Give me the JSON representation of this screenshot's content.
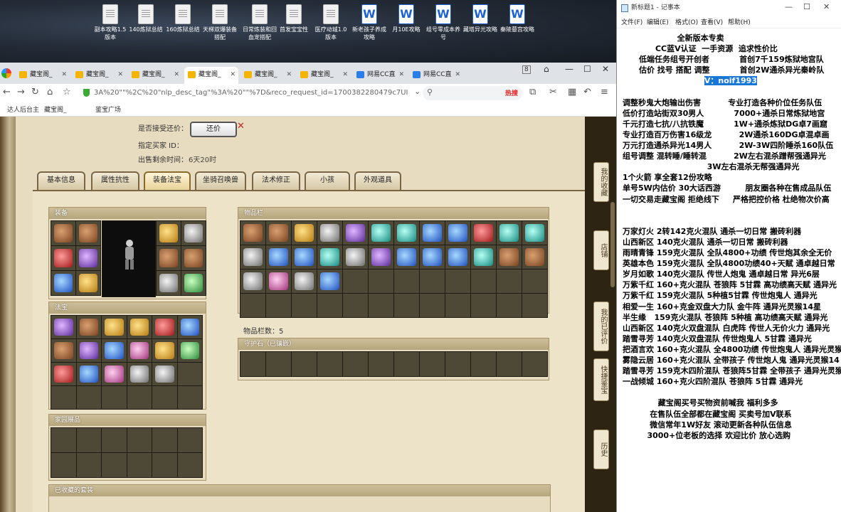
{
  "desktop": {
    "icons": [
      {
        "label": "副本攻略1.5版本",
        "type": "txt"
      },
      {
        "label": "140炼狱总结",
        "type": "txt"
      },
      {
        "label": "160炼狱总结",
        "type": "txt"
      },
      {
        "label": "天梯双爆装备搭配",
        "type": "txt"
      },
      {
        "label": "日常炼装和回血宠搭配",
        "type": "txt"
      },
      {
        "label": "首发宝宝性",
        "type": "txt"
      },
      {
        "label": "医疗动城1.0版本",
        "type": "txt"
      },
      {
        "label": "新老孩子养成攻略",
        "type": "wps"
      },
      {
        "label": "月10E攻略",
        "type": "wps"
      },
      {
        "label": "组号零成本养号",
        "type": "wps"
      },
      {
        "label": "藏塔异光攻略",
        "type": "wps"
      },
      {
        "label": "秦陵墓宫攻略",
        "type": "wps"
      }
    ]
  },
  "browser": {
    "tabs": [
      {
        "label": "藏宝阁_",
        "icon": "cbg-icon"
      },
      {
        "label": "藏宝阁_",
        "icon": "cbg-icon"
      },
      {
        "label": "藏宝阁_",
        "icon": "cbg-icon"
      },
      {
        "label": "藏宝阁_",
        "icon": "cbg-icon",
        "active": true
      },
      {
        "label": "藏宝阁_",
        "icon": "cbg-icon"
      },
      {
        "label": "藏宝阁_",
        "icon": "cbg-icon"
      },
      {
        "label": "网易CC直",
        "icon": "cc-icon"
      },
      {
        "label": "网易CC直",
        "icon": "cc-icon"
      }
    ],
    "tab_count": "8",
    "url": "3A%20\"\"%2C%20\"nlp_desc_tag\"%3A%20\"\"%7D&reco_request_id=1700382280479c7UI",
    "search_hot": "热搜",
    "bookmarks": [
      "达人后台主",
      "藏宝阁_",
      "鉴宝广场"
    ]
  },
  "trade": {
    "accept_counter_label": "是否接受还价：",
    "counter_button": "还价",
    "buyer_label": "指定买家 ID：",
    "time_label": "出售剩余时间：",
    "time_value": "6天20时"
  },
  "page_tabs": [
    {
      "label": "基本信息"
    },
    {
      "label": "属性抗性"
    },
    {
      "label": "装备法宝",
      "active": true
    },
    {
      "label": "坐骑召唤兽"
    },
    {
      "label": "法术修正"
    },
    {
      "label": "小孩"
    },
    {
      "label": "外观道具"
    }
  ],
  "panels": {
    "equip_title": "装备",
    "fabao_title": "法宝",
    "home_title": "家园展品",
    "inventory_title": "物品栏",
    "inventory_count": "物品栏数：5",
    "guard_title": "守护石（已镶嵌）",
    "collected_title": "已收藏的套装"
  },
  "right_rail": [
    "我的收藏",
    "店铺",
    "我的已评价",
    "快捷鉴宝",
    "历史"
  ],
  "notepad": {
    "title": "新标题1 - 记事本",
    "menu": [
      "文件(F)",
      "编辑(E)",
      "格式(O)",
      "查看(V)",
      "帮助(H)"
    ],
    "lines": [
      "                    全新版本专卖",
      "            CC蓝V认证  一手资源  追求性价比",
      "      低端任务组号开创者           首创7千159炼狱地宫队",
      "      估价 找号 搭配 调整           首创2W通杀异光秦岭队",
      "                              V：noif1993",
      "",
      "调整秒鬼大炮输出伤害          专业打造各种价位任务队伍",
      "低价打造站街双30男人           7000+通杀日常炼狱地宫",
      "千元打造七抗/八抗铁魔           1W+通杀炼狱DG卓7画窟",
      "专业打造百万伤害16级龙          2W通杀160DG卓混卓画",
      "万元打造通杀异光14男人          2W-3W四阶睡杀160队伍",
      "组号调整 混转睡/睡转混          2W左右混杀蹭帮强通异光",
      "                               3W左右混杀无帮强通异光",
      "1个火箭 享全套12份攻略",
      "单号5W内估价 30大话西游         朋友圈各种在售成品队伍",
      "一切交易走藏宝阁 拒绝线下     严格把控价格 杜绝物次价高",
      "",
      "",
      "万家灯火 2转142克火混队 通杀一切日常 搬砖利器",
      "山西新区 140克火混队 通杀一切日常 搬砖利器",
      "雨晴青锋 159克火混队 全队4800+功绩 传世炮其余全无价",
      "英雄本色 159克火混队 全队4800功绩40+天赋 通卓越日常",
      "岁月如歌 140克火混队 传世人炮鬼 通卓越日常 异光6层",
      "万紫千红 160+克火混队 苍狼阵 5甘霖 高功绩高天赋 通异光",
      "万紫千红 159克火混队 5种植5甘霖 传世炮鬼人 通异光",
      "相爱一生 160+克金双盘大力队 金牛阵 通异光灵猴14星",
      "半生缘   159克火混队 苍狼阵 5种植 高功绩高天赋 通异光",
      "山西新区 140克火双盘混队 白虎阵 传世人无价火力 通异光",
      "踏雪寻芳 140克火双盘混队 传世炮鬼人 5甘霖 通异光",
      "把酒言欢 160+克火混队 全4800功绩 传世炮鬼人 通异光灵猴",
      "雾隐云居 160+克火混队 全带孩子 传世炮人鬼 通异光灵猴14",
      "踏雪寻芳 159克木四阶混队 苍狼阵5甘霖 全带孩子 通异光灵猴",
      "一战倾城 160+克火四阶混队 苍狼阵 5甘霖 通异光",
      "",
      "             藏宝阁买号买物资前喊我 福利多多",
      "          在售队伍全部都在藏宝阁 买卖号加V联系",
      "          微信常年1W好友 滚动更新各种队伍信息",
      "         3000+位老板的选择 欢迎比价 放心选购"
    ]
  }
}
